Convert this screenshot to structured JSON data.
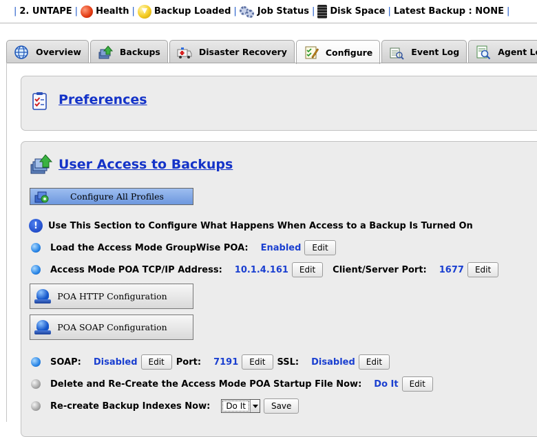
{
  "status_bar": {
    "device": "2. UNTAPE",
    "health": "Health",
    "backup_loaded": "Backup Loaded",
    "job_status": "Job Status",
    "disk_space": "Disk Space",
    "latest_backup": "Latest Backup : NONE"
  },
  "tabs": [
    {
      "label": "Overview",
      "icon": "globe-icon",
      "active": false
    },
    {
      "label": "Backups",
      "icon": "backups-stack-icon",
      "active": false
    },
    {
      "label": "Disaster Recovery",
      "icon": "ambulance-icon",
      "active": false
    },
    {
      "label": "Configure",
      "icon": "checklist-icon",
      "active": true
    },
    {
      "label": "Event Log",
      "icon": "event-log-icon",
      "active": false
    },
    {
      "label": "Agent Log",
      "icon": "agent-log-icon",
      "active": false
    }
  ],
  "preferences": {
    "title": "Preferences"
  },
  "user_access": {
    "title": "User Access to Backups",
    "configure_all_label": "Configure All Profiles",
    "info_text": "Use This Section to Configure What Happens When Access to a Backup Is Turned On",
    "load_poa": {
      "label": "Load the Access Mode GroupWise POA:",
      "value": "Enabled",
      "edit": "Edit"
    },
    "poa_address": {
      "label": "Access Mode POA TCP/IP Address:",
      "value": "10.1.4.161",
      "edit": "Edit",
      "port_label": "Client/Server Port:",
      "port_value": "1677",
      "port_edit": "Edit"
    },
    "poa_http_label": "POA HTTP Configuration",
    "poa_soap_label": "POA SOAP Configuration",
    "soap": {
      "label": "SOAP:",
      "value": "Disabled",
      "edit": "Edit",
      "port_label": "Port:",
      "port_value": "7191",
      "port_edit": "Edit",
      "ssl_label": "SSL:",
      "ssl_value": "Disabled",
      "ssl_edit": "Edit"
    },
    "recreate_startup": {
      "label": "Delete and Re-Create the Access Mode POA Startup File Now:",
      "value": "Do It",
      "edit": "Edit"
    },
    "recreate_indexes": {
      "label": "Re-create Backup Indexes Now:",
      "selected": "Do It",
      "save": "Save"
    }
  },
  "colors": {
    "link_blue": "#1433c8",
    "value_blue": "#1a3fd0",
    "separator_blue": "#1a56c8",
    "panel_bg": "#ececec"
  }
}
